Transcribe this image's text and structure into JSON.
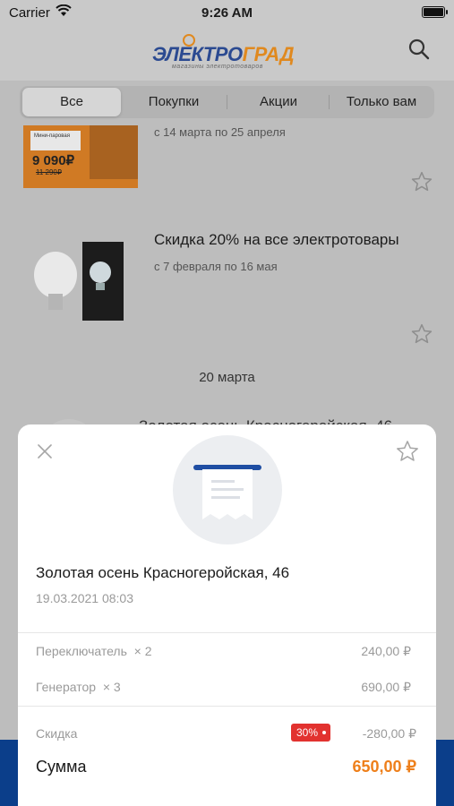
{
  "status_bar": {
    "carrier": "Carrier",
    "time": "9:26 AM"
  },
  "header": {
    "logo_main_1": "ЭЛЕКТРО",
    "logo_main_2": "ГРАД",
    "logo_sub": "магазины электротоваров"
  },
  "tabs": [
    {
      "label": "Все",
      "active": true
    },
    {
      "label": "Покупки",
      "active": false
    },
    {
      "label": "Акции",
      "active": false
    },
    {
      "label": "Только вам",
      "active": false
    }
  ],
  "promos": [
    {
      "title": "",
      "date": "с 14 марта по 25 апреля",
      "image_text": {
        "line1": "Мини-паровая",
        "price": "9 090₽",
        "old_price": "11 290₽"
      }
    },
    {
      "title": "Скидка 20% на все электротовары",
      "date": "с 7 февраля по 16 мая"
    }
  ],
  "date_header": "20 марта",
  "background_receipt_title": "Золотая осень Красногеройская, 46",
  "receipt": {
    "store": "Золотая осень Красногеройская, 46",
    "datetime": "19.03.2021 08:03",
    "items": [
      {
        "name": "Переключатель",
        "qty": "× 2",
        "amount": "240,00 ₽"
      },
      {
        "name": "Генератор",
        "qty": "× 3",
        "amount": "690,00 ₽"
      }
    ],
    "discount_label": "Скидка",
    "discount_badge": "30%",
    "discount_amount": "-280,00 ₽",
    "total_label": "Сумма",
    "total_amount": "650,00 ₽"
  },
  "colors": {
    "brand_blue": "#2b4a91",
    "accent_orange": "#ee7f1a",
    "badge_red": "#e2322f"
  }
}
